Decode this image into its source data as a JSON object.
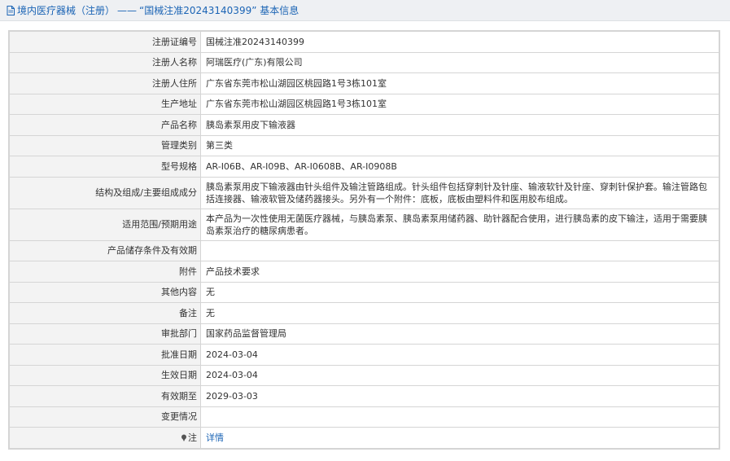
{
  "header": {
    "section": "境内医疗器械（注册）",
    "separator": "——",
    "title": "“国械注准20243140399” 基本信息"
  },
  "rows": [
    {
      "label": "注册证编号",
      "value": "国械注准20243140399"
    },
    {
      "label": "注册人名称",
      "value": "阿瑞医疗(广东)有限公司"
    },
    {
      "label": "注册人住所",
      "value": "广东省东莞市松山湖园区桃园路1号3栋101室"
    },
    {
      "label": "生产地址",
      "value": "广东省东莞市松山湖园区桃园路1号3栋101室"
    },
    {
      "label": "产品名称",
      "value": "胰岛素泵用皮下输液器"
    },
    {
      "label": "管理类别",
      "value": "第三类"
    },
    {
      "label": "型号规格",
      "value": "AR-I06B、AR-I09B、AR-I0608B、AR-I0908B"
    },
    {
      "label": "结构及组成/主要组成成分",
      "value": "胰岛素泵用皮下输液器由针头组件及输注管路组成。针头组件包括穿刺针及针座、输液软针及针座、穿刺针保护套。输注管路包括连接器、输液软管及储药器接头。另外有一个附件：底板，底板由塑料件和医用胶布组成。"
    },
    {
      "label": "适用范围/预期用途",
      "value": "本产品为一次性使用无菌医疗器械，与胰岛素泵、胰岛素泵用储药器、助针器配合使用，进行胰岛素的皮下输注，适用于需要胰岛素泵治疗的糖尿病患者。"
    },
    {
      "label": "产品储存条件及有效期",
      "value": ""
    },
    {
      "label": "附件",
      "value": "产品技术要求"
    },
    {
      "label": "其他内容",
      "value": "无"
    },
    {
      "label": "备注",
      "value": "无"
    },
    {
      "label": "审批部门",
      "value": "国家药品监督管理局"
    },
    {
      "label": "批准日期",
      "value": "2024-03-04"
    },
    {
      "label": "生效日期",
      "value": "2024-03-04"
    },
    {
      "label": "有效期至",
      "value": "2029-03-03"
    },
    {
      "label": "变更情况",
      "value": ""
    }
  ],
  "note_row": {
    "label": "注",
    "icon": "note-icon",
    "link": "详情"
  },
  "colors": {
    "link": "#1b64b5",
    "label_bg": "#f3f3f3",
    "border": "#d5d5d5",
    "header_bg": "#eef0f3"
  }
}
